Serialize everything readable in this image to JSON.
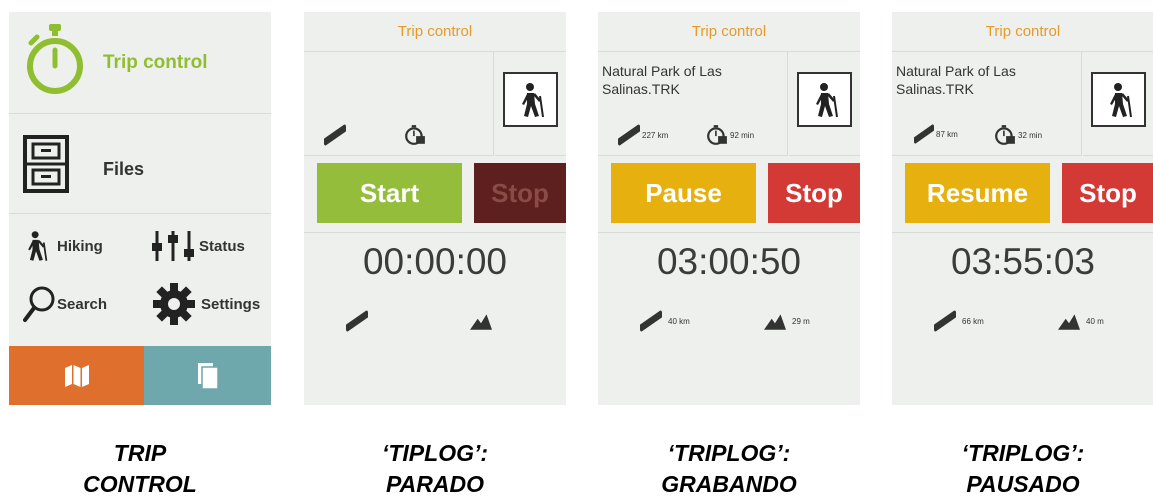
{
  "menu": {
    "trip_control": "Trip control",
    "files": "Files",
    "hiking": "Hiking",
    "status": "Status",
    "search": "Search",
    "settings": "Settings"
  },
  "screens": {
    "stopped": {
      "header": "Trip control",
      "start": "Start",
      "stop": "Stop",
      "time": "00:00:00"
    },
    "recording": {
      "header": "Trip control",
      "track": "Natural Park of Las Salinas.TRK",
      "distance_total": "227 km",
      "time_total": "92 min",
      "pause": "Pause",
      "stop": "Stop",
      "time": "03:00:50",
      "distance": "40 km",
      "altitude": "29 m"
    },
    "paused": {
      "header": "Trip control",
      "track": "Natural Park of Las Salinas.TRK",
      "distance_total": "87 km",
      "time_total": "32 min",
      "resume": "Resume",
      "stop": "Stop",
      "time": "03:55:03",
      "distance": "66 km",
      "altitude": "40 m"
    }
  },
  "captions": [
    "TRIP\nCONTROL",
    "‘TIPLOG’:\nPARADO",
    "‘TRIPLOG’:\nGRABANDO",
    "‘TRIPLOG’:\nPAUSADO"
  ],
  "colors": {
    "green": "#8fbf30",
    "orange_header": "#e59a2a",
    "yellow": "#e6b10f",
    "red": "#d33a35",
    "dark_red": "#5e1f1f",
    "map_orange": "#de6f2c",
    "teal": "#6ea7ac"
  },
  "icons": [
    "stopwatch-icon",
    "file-cabinet-icon",
    "hiker-icon",
    "equalizer-icon",
    "magnifier-icon",
    "gear-icon",
    "map-icon",
    "pages-icon",
    "ruler-icon",
    "timer-icon",
    "altitude-icon"
  ]
}
